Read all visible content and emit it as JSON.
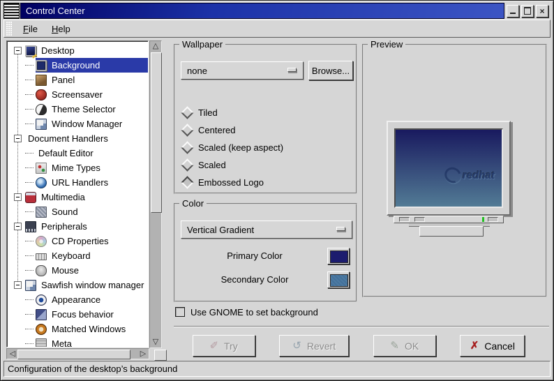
{
  "window": {
    "title": "Control Center",
    "controls": {
      "close_glyph": "×"
    }
  },
  "menu": {
    "items": [
      {
        "label": "File"
      },
      {
        "label": "Help"
      }
    ]
  },
  "tree": {
    "items": [
      {
        "label": "Desktop",
        "level": 0,
        "expander": true,
        "icon": "desktop",
        "selected": false
      },
      {
        "label": "Background",
        "level": 1,
        "expander": false,
        "icon": "background",
        "selected": true
      },
      {
        "label": "Panel",
        "level": 1,
        "expander": false,
        "icon": "panel",
        "selected": false
      },
      {
        "label": "Screensaver",
        "level": 1,
        "expander": false,
        "icon": "screensaver",
        "selected": false
      },
      {
        "label": "Theme Selector",
        "level": 1,
        "expander": false,
        "icon": "theme-selector",
        "selected": false
      },
      {
        "label": "Window Manager",
        "level": 1,
        "expander": false,
        "icon": "window-manager",
        "selected": false
      },
      {
        "label": "Document Handlers",
        "level": 0,
        "expander": true,
        "icon": null,
        "selected": false
      },
      {
        "label": "Default Editor",
        "level": 1,
        "expander": false,
        "icon": null,
        "selected": false
      },
      {
        "label": "Mime Types",
        "level": 1,
        "expander": false,
        "icon": "mime-types",
        "selected": false
      },
      {
        "label": "URL Handlers",
        "level": 1,
        "expander": false,
        "icon": "url-handlers",
        "selected": false
      },
      {
        "label": "Multimedia",
        "level": 0,
        "expander": true,
        "icon": "multimedia",
        "selected": false
      },
      {
        "label": "Sound",
        "level": 1,
        "expander": false,
        "icon": "sound",
        "selected": false
      },
      {
        "label": "Peripherals",
        "level": 0,
        "expander": true,
        "icon": "peripherals",
        "selected": false
      },
      {
        "label": "CD Properties",
        "level": 1,
        "expander": false,
        "icon": "cd-properties",
        "selected": false
      },
      {
        "label": "Keyboard",
        "level": 1,
        "expander": false,
        "icon": "keyboard",
        "selected": false
      },
      {
        "label": "Mouse",
        "level": 1,
        "expander": false,
        "icon": "mouse",
        "selected": false
      },
      {
        "label": "Sawfish window manager",
        "level": 0,
        "expander": true,
        "icon": "sawfish",
        "selected": false
      },
      {
        "label": "Appearance",
        "level": 1,
        "expander": false,
        "icon": "appearance",
        "selected": false
      },
      {
        "label": "Focus behavior",
        "level": 1,
        "expander": false,
        "icon": "focus-behavior",
        "selected": false
      },
      {
        "label": "Matched Windows",
        "level": 1,
        "expander": false,
        "icon": "matched-windows",
        "selected": false
      },
      {
        "label": "Meta",
        "level": 1,
        "expander": false,
        "icon": "meta",
        "selected": false
      }
    ]
  },
  "wallpaper": {
    "legend": "Wallpaper",
    "dropdown_value": "none",
    "browse_label": "Browse...",
    "modes": [
      {
        "label": "Tiled",
        "selected": false
      },
      {
        "label": "Centered",
        "selected": false
      },
      {
        "label": "Scaled (keep aspect)",
        "selected": false
      },
      {
        "label": "Scaled",
        "selected": false
      },
      {
        "label": "Embossed Logo",
        "selected": true
      }
    ]
  },
  "color": {
    "legend": "Color",
    "dropdown_value": "Vertical Gradient",
    "primary_label": "Primary Color",
    "secondary_label": "Secondary Color"
  },
  "preview": {
    "legend": "Preview",
    "logo_text": "redhat"
  },
  "gnome_checkbox": {
    "label": "Use GNOME to set background",
    "checked": false
  },
  "actions": [
    {
      "label": "Try",
      "glyph": "✐",
      "enabled": false
    },
    {
      "label": "Revert",
      "glyph": "↺",
      "enabled": false
    },
    {
      "label": "OK",
      "glyph": "✎",
      "enabled": false
    },
    {
      "label": "Cancel",
      "glyph": "✗",
      "enabled": true
    }
  ],
  "statusbar": {
    "text": "Configuration of the desktop’s background"
  },
  "scrollbars": {
    "up_glyph": "△",
    "down_glyph": "▽",
    "left_glyph": "◁",
    "right_glyph": "▷"
  },
  "colors": {
    "selection": "#2a3aa8",
    "titlebar_start": "#000060",
    "titlebar_end": "#3c55c4",
    "primary_color": "#1c1c6e",
    "secondary_color": "#4c7aa2",
    "secondary_color_dither": "#44719a",
    "screen_top": "#191a5f",
    "screen_bottom": "#527b95",
    "led_green": "#22c022"
  }
}
